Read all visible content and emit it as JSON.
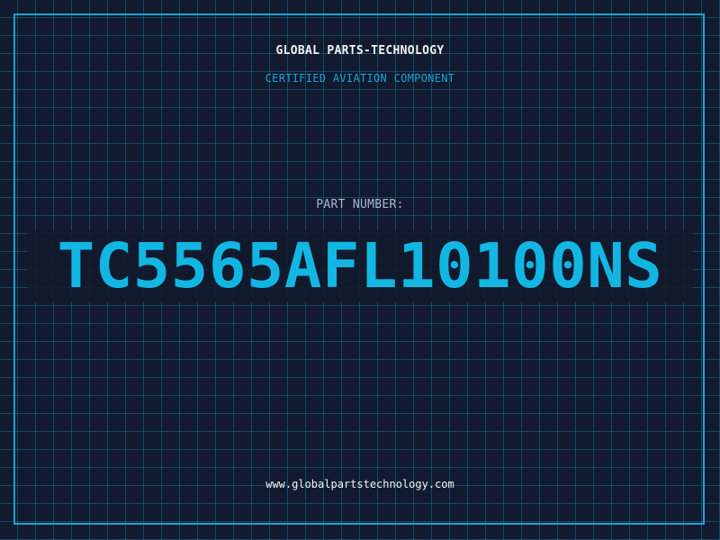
{
  "header": {
    "brand": "GLOBAL PARTS-TECHNOLOGY",
    "subtitle": "CERTIFIED AVIATION COMPONENT"
  },
  "part": {
    "label": "PART NUMBER:",
    "number": "TC5565AFL10100NS"
  },
  "footer": {
    "website": "www.globalpartstechnology.com"
  },
  "colors": {
    "background": "#111a2e",
    "grid": "#1f6e8c",
    "accent": "#12b6e3",
    "frame": "#1aa3d1",
    "text_light": "#f2f2f2",
    "text_muted": "#a8b6c8"
  }
}
